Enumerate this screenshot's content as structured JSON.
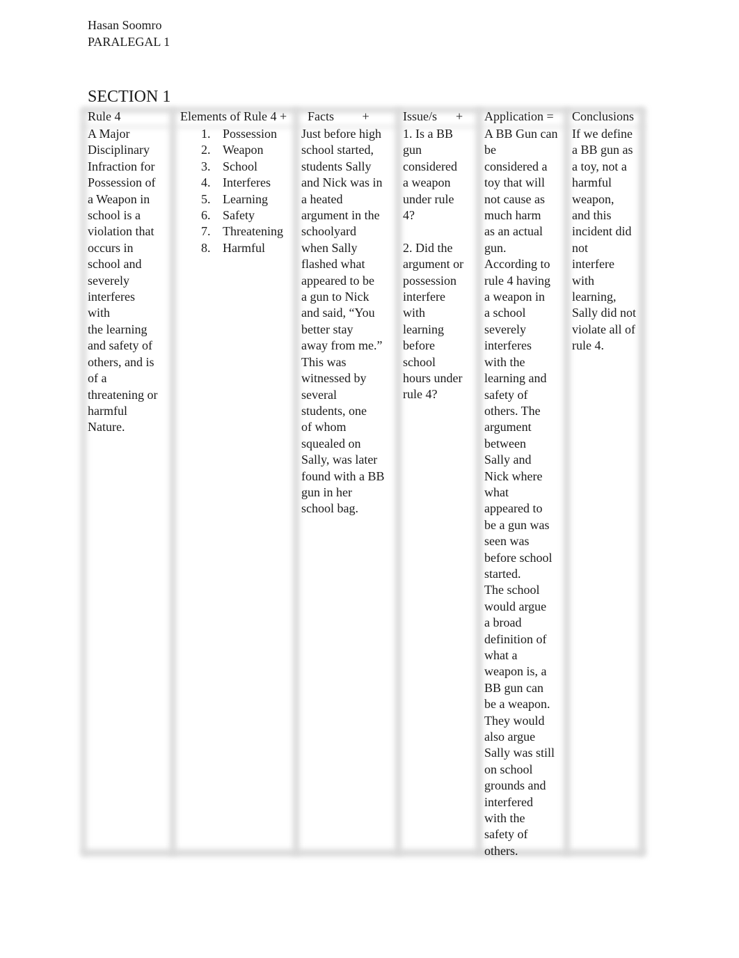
{
  "header": {
    "author": "Hasan Soomro",
    "course": "PARALEGAL 1"
  },
  "section_title": "SECTION 1",
  "table": {
    "columns": [
      {
        "header": "Rule 4"
      },
      {
        "header": "Elements of Rule 4 +"
      },
      {
        "header": "  Facts         +"
      },
      {
        "header": "Issue/s      +"
      },
      {
        "header": "Application ="
      },
      {
        "header": "Conclusions"
      }
    ],
    "rule": "A Major\nDisciplinary\nInfraction for\nPossession of\na Weapon in\nschool is a\nviolation that\noccurs in\nschool and\nseverely\ninterferes\nwith\nthe learning\nand safety of\nothers, and is\nof a\nthreatening or\nharmful\nNature.",
    "elements": [
      {
        "num": "1.",
        "label": "Possession"
      },
      {
        "num": "2.",
        "label": "Weapon"
      },
      {
        "num": "3.",
        "label": "School"
      },
      {
        "num": "4.",
        "label": "Interferes"
      },
      {
        "num": "5.",
        "label": "Learning"
      },
      {
        "num": "6.",
        "label": "Safety"
      },
      {
        "num": "7.",
        "label": "Threatening"
      },
      {
        "num": "8.",
        "label": "Harmful"
      }
    ],
    "facts": "Just before high\nschool started,\nstudents Sally\nand Nick was in\na heated\nargument in the\nschoolyard\nwhen Sally\nflashed what\nappeared to be\na gun to Nick\nand said, “You\nbetter stay\naway from me.”\nThis was\nwitnessed by\nseveral\nstudents, one\nof whom\nsquealed on\nSally, was later\nfound with a BB\ngun in her\nschool bag.",
    "issues": [
      "1. Is a BB\ngun\nconsidered\na weapon\nunder rule\n4?",
      "2. Did the\nargument or\npossession\ninterfere\nwith\nlearning\nbefore\nschool\nhours under\nrule 4?"
    ],
    "application": "A BB Gun can\nbe\nconsidered a\ntoy that will\nnot cause as\nmuch harm\nas an actual\ngun.\nAccording to\nrule 4 having\na weapon in\na school\nseverely\ninterferes\nwith the\nlearning and\nsafety of\nothers. The\nargument\nbetween\nSally and\nNick where\nwhat\nappeared to\nbe a gun was\nseen was\nbefore school\nstarted.\nThe school\nwould argue\na broad\ndefinition of\nwhat a\nweapon is, a\nBB gun can\nbe a weapon.\nThey would\nalso argue\nSally was still\non school\ngrounds and\ninterfered\nwith the\nsafety of\nothers.",
    "conclusion": "If we define\na BB gun as\na toy, not a\nharmful\nweapon,\nand this\nincident did\nnot\ninterfere\nwith\nlearning,\nSally did not\nviolate all of\nrule 4."
  }
}
